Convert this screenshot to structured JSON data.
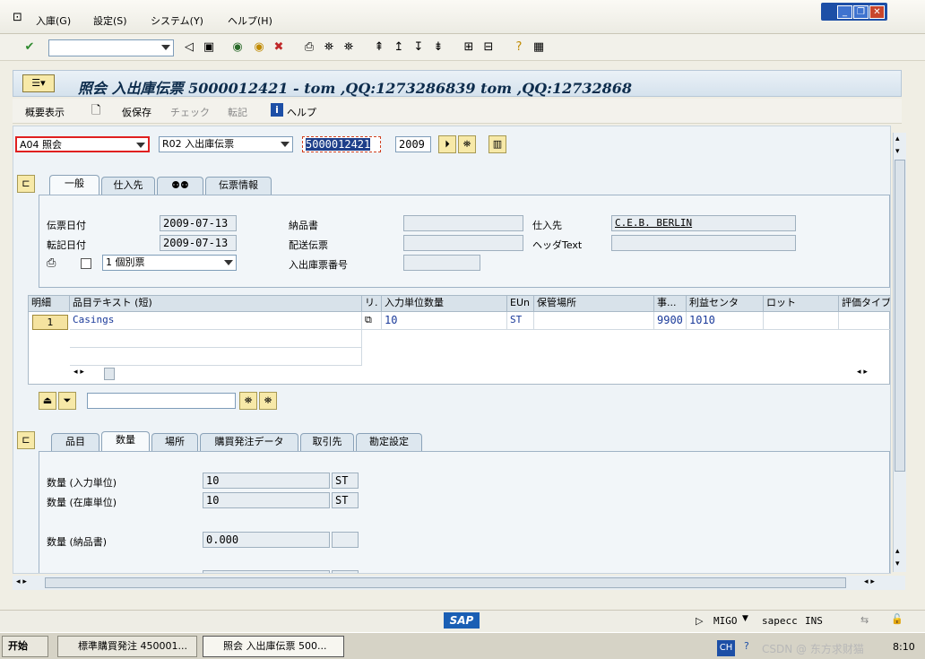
{
  "menu": {
    "items": [
      "入庫(G)",
      "設定(S)",
      "システム(Y)",
      "ヘルプ(H)"
    ]
  },
  "window_controls": {
    "minimize": "_",
    "restore": "❐",
    "close": "✕"
  },
  "toolbar": {
    "command_value": ""
  },
  "title": "照会 入出庫伝票 5000012421 - tom ,QQ:1273286839 tom ,QQ:12732868",
  "app_toolbar": {
    "overview": "概要表示",
    "hold": "仮保存",
    "check": "チェック",
    "post": "転記",
    "help": "ヘルプ"
  },
  "header": {
    "action": "A04 照会",
    "ref_doc": "R02 入出庫伝票",
    "doc_number": "5000012421",
    "year": "2009"
  },
  "tabs_top": [
    "一般",
    "仕入先",
    "",
    "伝票情報"
  ],
  "general": {
    "doc_date_label": "伝票日付",
    "doc_date": "2009-07-13",
    "post_date_label": "転記日付",
    "post_date": "2009-07-13",
    "print_select": "1 個別票",
    "delivery_note_label": "納品書",
    "delivery_note": "",
    "bill_label": "配送伝票",
    "bill": "",
    "gr_slip_label": "入出庫票番号",
    "gr_slip": "",
    "vendor_label": "仕入先",
    "vendor": "C.E.B. BERLIN",
    "header_text_label": "ヘッダText",
    "header_text": ""
  },
  "grid": {
    "headers": [
      "明細",
      "品目テキスト (短)",
      "リ.",
      "入力単位数量",
      "EUn",
      "保管場所",
      "事...",
      "利益センタ",
      "ロット",
      "評価タイプ"
    ],
    "rows": [
      {
        "line": "1",
        "text": "Casings",
        "qty": "10",
        "eun": "ST",
        "sloc": "",
        "plant": "9900",
        "profit": "1010",
        "batch": "",
        "val": ""
      }
    ]
  },
  "search_value": "",
  "tabs_bottom": [
    "品目",
    "数量",
    "場所",
    "購買発注データ",
    "取引先",
    "勘定設定"
  ],
  "quantity": {
    "qty_entry_label": "数量 (入力単位)",
    "qty_entry": "10",
    "qty_entry_unit": "ST",
    "qty_stock_label": "数量 (在庫単位)",
    "qty_stock": "10",
    "qty_stock_unit": "ST",
    "qty_dn_label": "数量 (納品書)",
    "qty_dn": "0.000",
    "qty_dn_unit": ""
  },
  "status": {
    "logo": "SAP",
    "tcode": "MIGO",
    "server": "sapecc",
    "mode": "INS"
  },
  "taskbar": {
    "start": "开始",
    "task1": "標準購買発注 450001...",
    "task2": "照会 入出庫伝票 500...",
    "lang": "CH",
    "time": "8:10",
    "watermark": "CSDN @ 东方求财猫"
  }
}
